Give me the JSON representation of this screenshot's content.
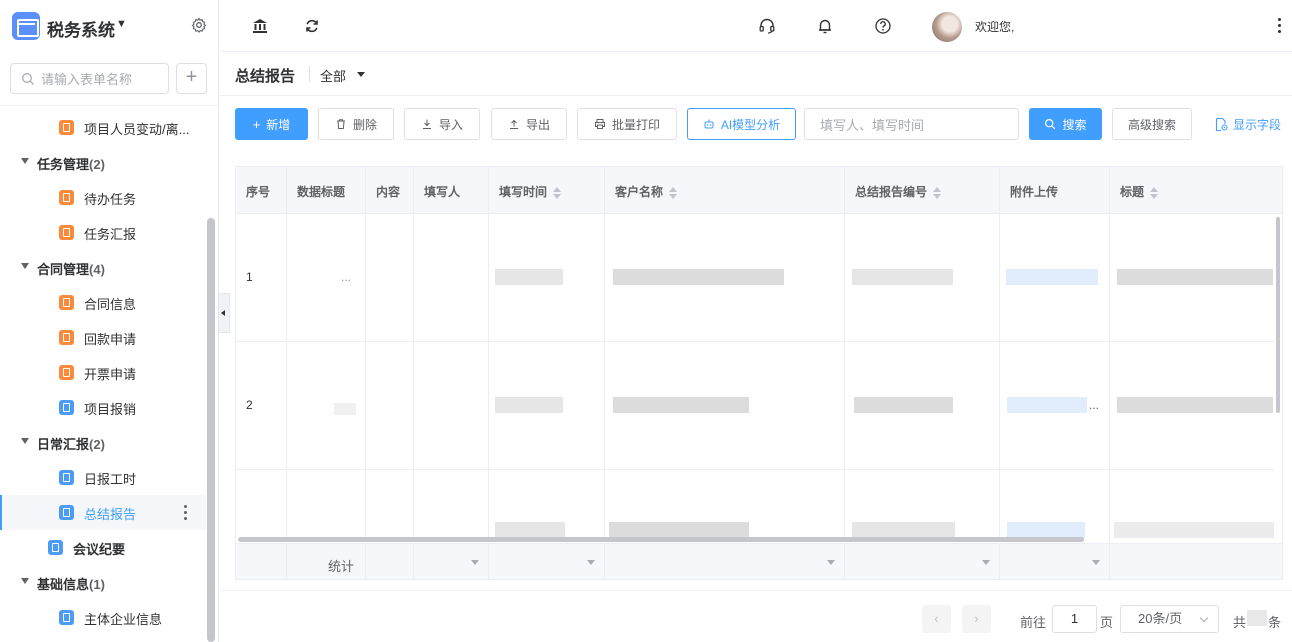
{
  "app": {
    "title": "税务系统"
  },
  "sidebar": {
    "search_placeholder": "请输入表单名称",
    "add_label": "+",
    "items": [
      {
        "label": "项目人员变动/离..."
      },
      {
        "group": "任务管理",
        "count": "(2)"
      },
      {
        "label": "待办任务"
      },
      {
        "label": "任务汇报"
      },
      {
        "group": "合同管理",
        "count": "(4)"
      },
      {
        "label": "合同信息"
      },
      {
        "label": "回款申请"
      },
      {
        "label": "开票申请"
      },
      {
        "label": "项目报销"
      },
      {
        "group": "日常汇报",
        "count": "(2)"
      },
      {
        "label": "日报工时"
      },
      {
        "label": "总结报告"
      },
      {
        "label": "会议纪要"
      },
      {
        "group": "基础信息",
        "count": "(1)"
      },
      {
        "label": "主体企业信息"
      }
    ]
  },
  "header": {
    "welcome": "欢迎您,"
  },
  "page": {
    "title": "总结报告",
    "filter": "全部"
  },
  "toolbar": {
    "new": "新增",
    "delete": "删除",
    "import": "导入",
    "export": "导出",
    "batch_print": "批量打印",
    "ai_analysis": "AI模型分析",
    "search_placeholder": "填写人、填写时间",
    "search": "搜索",
    "advanced_search": "高级搜索",
    "show_fields": "显示字段"
  },
  "table": {
    "columns": [
      "序号",
      "数据标题",
      "内容",
      "填写人",
      "填写时间",
      "客户名称",
      "总结报告编号",
      "附件上传",
      "标题"
    ],
    "rows": [
      {
        "index": "1",
        "title_ellipsis": "..."
      },
      {
        "index": "2",
        "attachment_ellipsis": "..."
      },
      {
        "index": ""
      }
    ],
    "footer_label": "统计"
  },
  "pagination": {
    "goto": "前往",
    "page": "1",
    "page_unit": "页",
    "page_size": "20条/页",
    "total_prefix": "共",
    "total_suffix": "条"
  },
  "colors": {
    "primary": "#409eff",
    "icon_orange": "#fb8a3c",
    "icon_blue": "#4c9bf5"
  }
}
